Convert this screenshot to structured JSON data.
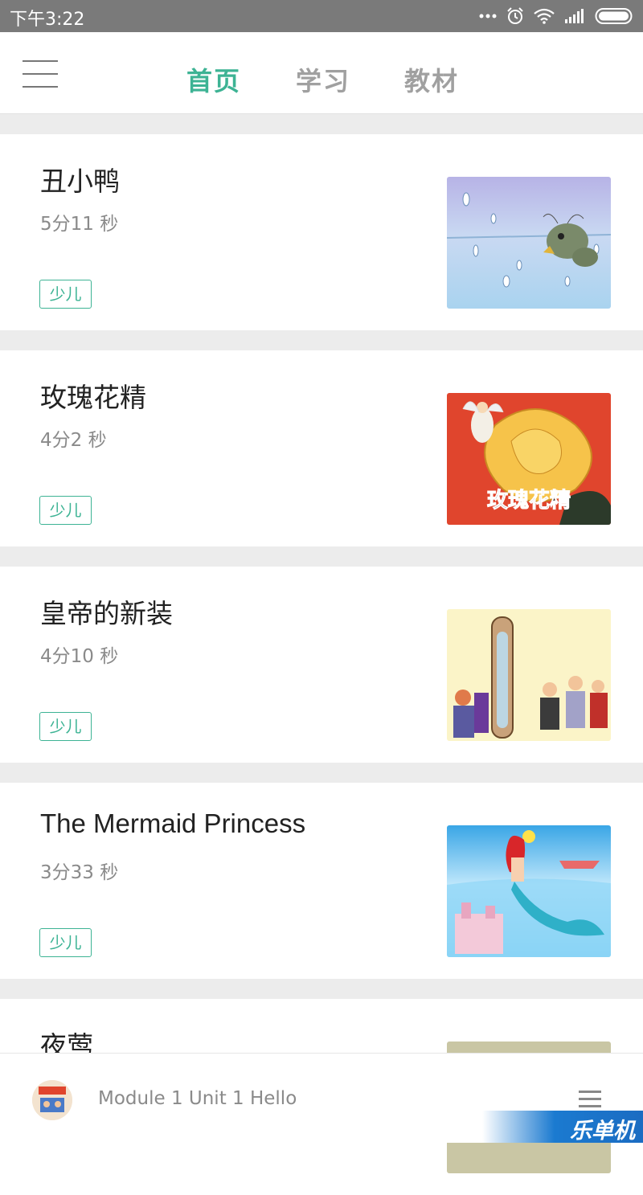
{
  "status_bar": {
    "time": "下午3:22"
  },
  "nav": {
    "tabs": [
      {
        "label": "首页",
        "active": true
      },
      {
        "label": "学习",
        "active": false
      },
      {
        "label": "教材",
        "active": false
      }
    ]
  },
  "colors": {
    "accent": "#3db394",
    "status_bar": "#7a7a7a",
    "watermark": "#1b7ad0"
  },
  "stories": [
    {
      "title": "丑小鸭",
      "duration": "5分11 秒",
      "tag": "少儿"
    },
    {
      "title": "玫瑰花精",
      "duration": "4分2 秒",
      "tag": "少儿",
      "thumbnail_text": "玫瑰花精"
    },
    {
      "title": "皇帝的新装",
      "duration": "4分10 秒",
      "tag": "少儿"
    },
    {
      "title": "The Mermaid Princess",
      "duration": "3分33 秒",
      "tag": "少儿"
    },
    {
      "title": "夜莺",
      "duration": "",
      "tag": ""
    }
  ],
  "player": {
    "now_playing": "Module 1 Unit 1 Hello"
  },
  "watermark": {
    "text": "乐单机"
  }
}
